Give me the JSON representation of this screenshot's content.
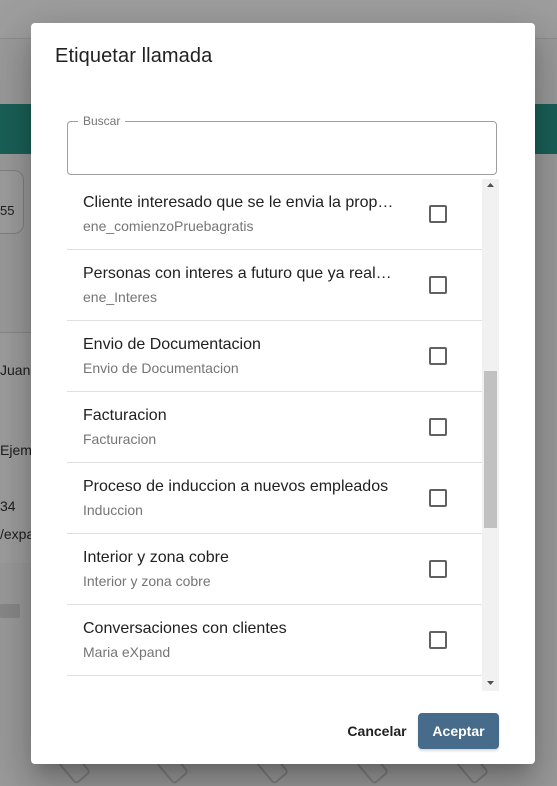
{
  "dialog": {
    "title": "Etiquetar llamada",
    "search": {
      "label": "Buscar",
      "value": "",
      "placeholder": ""
    },
    "items": [
      {
        "title": "Cliente interesado que se le envia la propuesta",
        "subtitle": "ene_comienzoPruebagratis",
        "checked": false
      },
      {
        "title": "Personas con interes a futuro que ya realizaron",
        "subtitle": "ene_Interes",
        "checked": false
      },
      {
        "title": "Envio de Documentacion",
        "subtitle": "Envio de Documentacion",
        "checked": false
      },
      {
        "title": "Facturacion",
        "subtitle": "Facturacion",
        "checked": false
      },
      {
        "title": "Proceso de induccion a nuevos empleados",
        "subtitle": "Induccion",
        "checked": false
      },
      {
        "title": "Interior y zona cobre",
        "subtitle": "Interior y zona cobre",
        "checked": false
      },
      {
        "title": "Conversaciones con clientes",
        "subtitle": "Maria eXpand",
        "checked": false
      }
    ],
    "buttons": {
      "cancel": "Cancelar",
      "accept": "Aceptar"
    }
  },
  "background": {
    "chip_text": "55",
    "texts": [
      "Juan",
      "Ejem",
      "34",
      "/expa"
    ]
  },
  "colors": {
    "accent": "#476b8a",
    "teal_header": "#2a9d8f"
  },
  "icons": [
    "scroll-up-arrow-icon",
    "scroll-down-arrow-icon",
    "checkbox-icon",
    "mail-icon"
  ]
}
